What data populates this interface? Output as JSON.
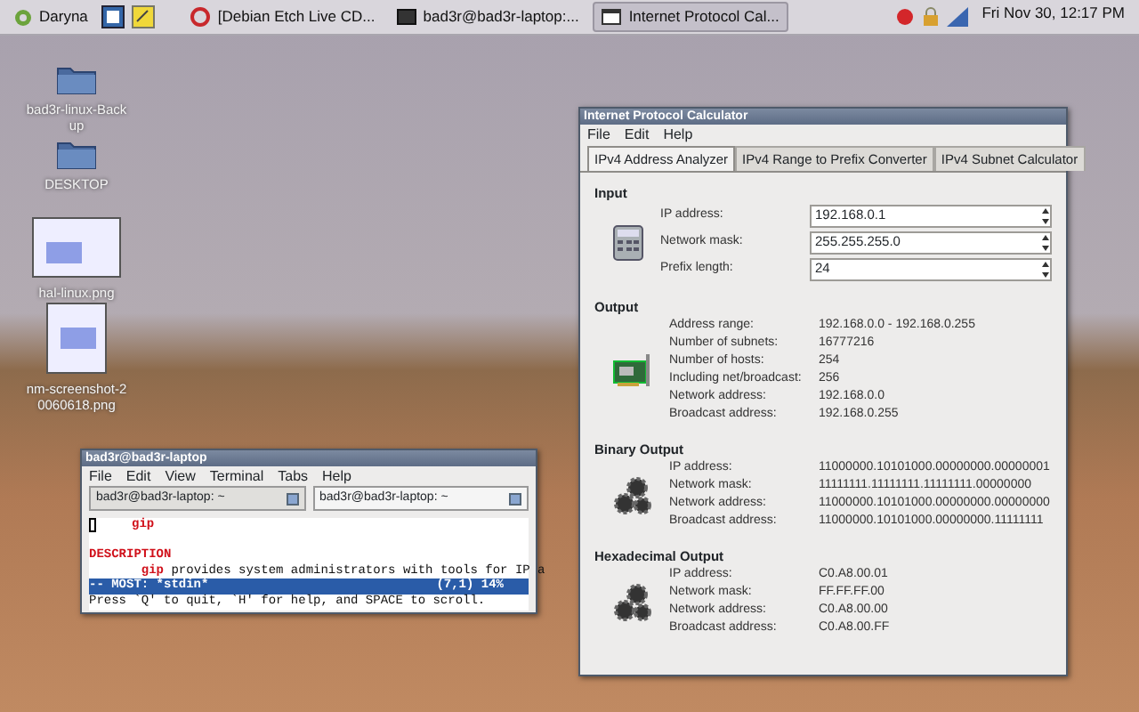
{
  "panel": {
    "menu_label": "Daryna",
    "tasks": [
      {
        "label": "[Debian Etch Live CD...",
        "kind": "browser",
        "selected": false
      },
      {
        "label": "bad3r@bad3r-laptop:...",
        "kind": "terminal",
        "selected": false
      },
      {
        "label": "Internet Protocol Cal...",
        "kind": "window",
        "selected": true
      }
    ],
    "clock": "Fri Nov 30, 12:17 PM"
  },
  "desktop_icons": [
    {
      "label": "bad3r-linux-Backup",
      "kind": "folder"
    },
    {
      "label": "DESKTOP",
      "kind": "folder"
    },
    {
      "label": "hal-linux.png",
      "kind": "image"
    },
    {
      "label": "nm-screenshot-20060618.png",
      "kind": "image"
    }
  ],
  "terminal": {
    "title": "bad3r@bad3r-laptop",
    "menu": [
      "File",
      "Edit",
      "View",
      "Terminal",
      "Tabs",
      "Help"
    ],
    "tabs": [
      {
        "label": "bad3r@bad3r-laptop: ~",
        "selected": false
      },
      {
        "label": "bad3r@bad3r-laptop: ~",
        "selected": true
      }
    ],
    "lines": [
      {
        "kind": "command",
        "command": "gip"
      },
      {
        "kind": "blank"
      },
      {
        "kind": "heading",
        "text": "DESCRIPTION"
      },
      {
        "kind": "command",
        "command": "gip",
        "text": " provides system administrators with tools for IP a"
      }
    ],
    "status": {
      "left": "-- MOST: *stdin*",
      "right": "(7,1) 14%"
    },
    "prompt": "Press `Q' to quit, `H' for help, and SPACE to scroll."
  },
  "calculator": {
    "title": "Internet Protocol Calculator",
    "menu": [
      "File",
      "Edit",
      "Help"
    ],
    "tabs": [
      {
        "label": "IPv4 Address Analyzer",
        "selected": true
      },
      {
        "label": "IPv4 Range to Prefix Converter",
        "selected": false
      },
      {
        "label": "IPv4 Subnet Calculator",
        "selected": false
      }
    ],
    "sections": [
      {
        "title": "Input",
        "kind": "input",
        "rows": [
          {
            "label": "IP address:",
            "value": "192.168.0.1"
          },
          {
            "label": "Network mask:",
            "value": "255.255.255.0"
          },
          {
            "label": "Prefix length:",
            "value": "24"
          }
        ]
      },
      {
        "title": "Output",
        "kind": "output",
        "rows": [
          {
            "label": "Address range:",
            "value": "192.168.0.0  -  192.168.0.255"
          },
          {
            "label": "Number of subnets:",
            "value": "16777216"
          },
          {
            "label": "Number of hosts:",
            "value": "254"
          },
          {
            "label": "Including net/broadcast:",
            "value": "256"
          },
          {
            "label": "Network address:",
            "value": "192.168.0.0"
          },
          {
            "label": "Broadcast address:",
            "value": "192.168.0.255"
          }
        ]
      },
      {
        "title": "Binary Output",
        "kind": "output",
        "rows": [
          {
            "label": "IP address:",
            "value": "11000000.10101000.00000000.00000001"
          },
          {
            "label": "Network mask:",
            "value": "11111111.11111111.11111111.00000000"
          },
          {
            "label": "Network address:",
            "value": "11000000.10101000.00000000.00000000"
          },
          {
            "label": "Broadcast address:",
            "value": "11000000.10101000.00000000.11111111"
          }
        ]
      },
      {
        "title": "Hexadecimal Output",
        "kind": "output",
        "rows": [
          {
            "label": "IP address:",
            "value": "C0.A8.00.01"
          },
          {
            "label": "Network mask:",
            "value": "FF.FF.FF.00"
          },
          {
            "label": "Network address:",
            "value": "C0.A8.00.00"
          },
          {
            "label": "Broadcast address:",
            "value": "C0.A8.00.FF"
          }
        ]
      }
    ]
  }
}
